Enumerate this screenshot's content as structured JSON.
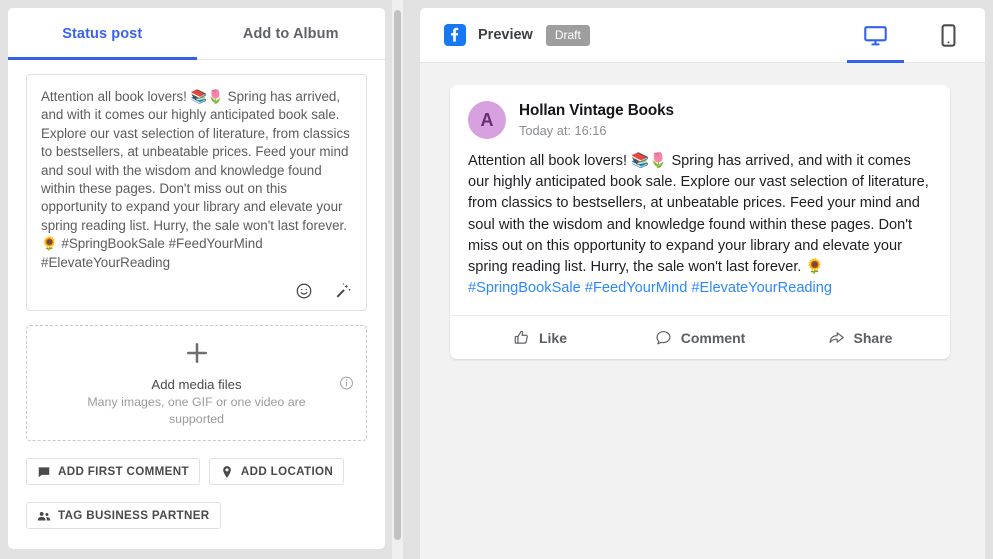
{
  "composer": {
    "tabs": [
      {
        "label": "Status post",
        "active": true
      },
      {
        "label": "Add to Album",
        "active": false
      }
    ],
    "post_text": "Attention all book lovers! 📚🌷 Spring has arrived, and with it comes our highly anticipated book sale. Explore our vast selection of literature, from classics to bestsellers, at unbeatable prices. Feed your mind and soul with the wisdom and knowledge found within these pages. Don't miss out on this opportunity to expand your library and elevate your spring reading list. Hurry, the sale won't last forever. 🌻 #SpringBookSale #FeedYourMind #ElevateYourReading",
    "tools": [
      {
        "icon": "emoji-icon"
      },
      {
        "icon": "magic-wand-icon"
      }
    ],
    "media": {
      "title": "Add media files",
      "subtitle": "Many images, one GIF or one video are supported",
      "plus_icon": "plus-icon",
      "info_icon": "info-icon"
    },
    "chips": [
      {
        "label": "ADD FIRST COMMENT",
        "icon": "comment-icon"
      },
      {
        "label": "ADD LOCATION",
        "icon": "location-pin-icon"
      },
      {
        "label": "TAG BUSINESS PARTNER",
        "icon": "people-icon"
      }
    ]
  },
  "preview": {
    "network_icon": "facebook-icon",
    "title": "Preview",
    "status_badge": "Draft",
    "devices": [
      {
        "name": "desktop",
        "icon": "desktop-monitor-icon",
        "active": true
      },
      {
        "name": "mobile",
        "icon": "mobile-phone-icon",
        "active": false
      }
    ],
    "post": {
      "avatar_initial": "A",
      "author": "Hollan Vintage Books",
      "timestamp": "Today at: 16:16",
      "body_plain": "Attention all book lovers! 📚🌷 Spring has arrived, and with it comes our highly anticipated book sale. Explore our vast selection of literature, from classics to bestsellers, at unbeatable prices. Feed your mind and soul with the wisdom and knowledge found within these pages. Don't miss out on this opportunity to expand your library and elevate your spring reading list. Hurry, the sale won't last forever. 🌻 ",
      "hashtags": "#SpringBookSale #FeedYourMind #ElevateYourReading",
      "actions": [
        {
          "label": "Like",
          "icon": "thumbs-up-icon"
        },
        {
          "label": "Comment",
          "icon": "comment-bubble-icon"
        },
        {
          "label": "Share",
          "icon": "share-arrow-icon"
        }
      ]
    }
  },
  "colors": {
    "accent_blue": "#3361e8",
    "facebook_blue": "#1877f2",
    "hashtag_blue": "#2d88ff",
    "draft_gray": "#9e9e9e",
    "avatar_bg": "#d7a0de"
  }
}
